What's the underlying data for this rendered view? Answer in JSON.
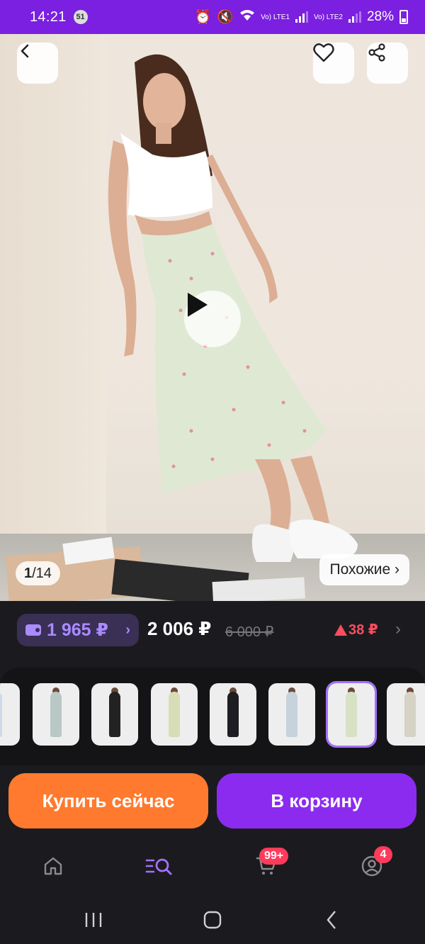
{
  "status_bar": {
    "time": "14:21",
    "notification_count": "51",
    "battery": "28%",
    "sim1": "Vo) LTE1",
    "sim2": "Vo) LTE2"
  },
  "gallery": {
    "counter_current": "1",
    "counter_total": "/14",
    "similar_label": "Похожие ›"
  },
  "price": {
    "wallet_price": "1 965 ₽",
    "main_price": "2 006 ₽",
    "old_price": "6 000 ₽",
    "delta": "38 ₽",
    "delta_color": "#ff4d5e"
  },
  "variants": [
    {
      "name": "variant-1",
      "skirt": "#cfd8e6"
    },
    {
      "name": "variant-2",
      "skirt": "#b9c8c4"
    },
    {
      "name": "variant-3",
      "skirt": "#222222"
    },
    {
      "name": "variant-4",
      "skirt": "#d8ddb8"
    },
    {
      "name": "variant-5",
      "skirt": "#1e1e22"
    },
    {
      "name": "variant-6",
      "skirt": "#c6d2dc"
    },
    {
      "name": "variant-7",
      "skirt": "#d7e1c6"
    },
    {
      "name": "variant-8",
      "skirt": "#d6d2c4"
    }
  ],
  "actions": {
    "buy_now": "Купить сейчас",
    "add_to_cart": "В корзину"
  },
  "bottom_nav": {
    "cart_badge": "99+",
    "profile_badge": "4",
    "active_color": "#a570ff"
  },
  "colors": {
    "status_bar": "#7b1fe0",
    "buy_button": "#ff7a2e",
    "cart_button": "#8c2bf0"
  }
}
